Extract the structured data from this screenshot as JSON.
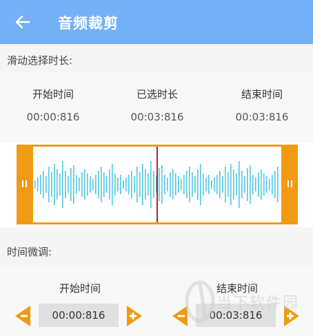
{
  "appbar": {
    "title": "音频裁剪",
    "back_icon": "arrow-left-icon",
    "color": "#74b0f6"
  },
  "range_section": {
    "label": "滑动选择时长:",
    "columns": [
      {
        "heading": "开始时间",
        "value": "00:00:816"
      },
      {
        "heading": "已选时长",
        "value": "00:03:816"
      },
      {
        "heading": "结束时间",
        "value": "00:03:816"
      }
    ]
  },
  "waveform": {
    "accent": "#f09b13",
    "wave_color": "#4ec8e0",
    "playhead_color": "#b71c2c",
    "playhead_fraction": 0.5
  },
  "fine_tune": {
    "label": "时间微调:",
    "start": {
      "heading": "开始时间",
      "value": "00:00:816"
    },
    "end": {
      "heading": "结束时间",
      "value": "00:03:816"
    },
    "minus_icon": "minus-arrow-icon",
    "plus_icon": "plus-arrow-icon"
  },
  "watermark": {
    "text": "当下软件园"
  }
}
